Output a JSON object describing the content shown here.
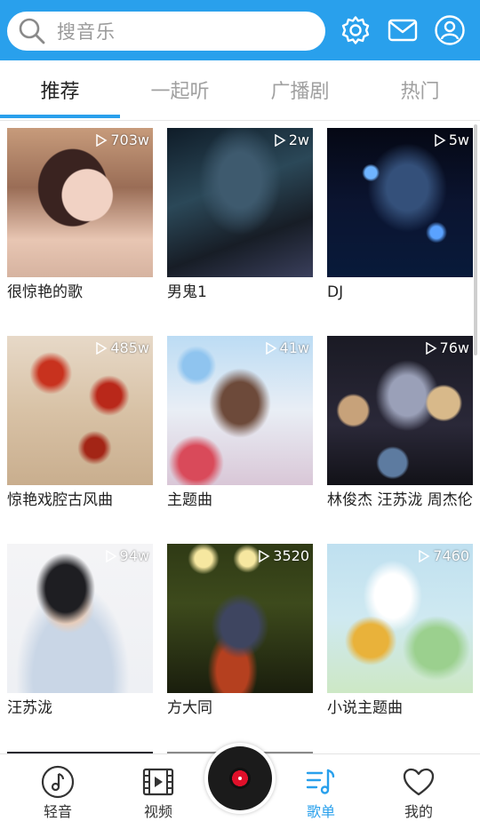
{
  "search": {
    "placeholder": "搜音乐"
  },
  "tabs": [
    {
      "label": "推荐"
    },
    {
      "label": "一起听"
    },
    {
      "label": "广播剧"
    },
    {
      "label": "热门"
    }
  ],
  "playlists": [
    {
      "title": "很惊艳的歌",
      "plays": "703w"
    },
    {
      "title": "男鬼1",
      "plays": "2w"
    },
    {
      "title": "DJ",
      "plays": "5w"
    },
    {
      "title": "惊艳戏腔古风曲",
      "plays": "485w"
    },
    {
      "title": "主题曲",
      "plays": "41w"
    },
    {
      "title": "林俊杰 汪苏泷 周杰伦",
      "plays": "76w"
    },
    {
      "title": "汪苏泷",
      "plays": "94w"
    },
    {
      "title": "方大同",
      "plays": "3520"
    },
    {
      "title": "小说主题曲",
      "plays": "7460"
    }
  ],
  "bottom_nav": [
    {
      "label": "轻音"
    },
    {
      "label": "视频"
    },
    {
      "label": "歌单"
    },
    {
      "label": "我的"
    }
  ],
  "colors": {
    "accent": "#29a0ec"
  }
}
